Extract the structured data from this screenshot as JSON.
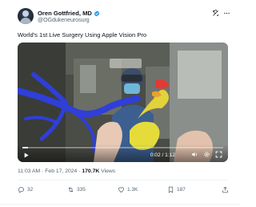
{
  "author": {
    "display_name": "Oren Gottfried, MD",
    "handle": "@OGdukeneurosurg",
    "verified": true,
    "verified_color": "#1d9bf0"
  },
  "header_actions": [
    "grok-icon",
    "more-icon"
  ],
  "tweet": {
    "text": "World's 1st Live Surgery Using Apple Vision Pro"
  },
  "video": {
    "current_time": "0:02",
    "duration": "1:12",
    "progress_fraction": 0.028,
    "controls": [
      "play-icon",
      "volume-icon",
      "settings-icon",
      "fullscreen-icon"
    ]
  },
  "meta": {
    "time": "11:03 AM",
    "separator": "·",
    "date": "Feb 17, 2024",
    "views_count": "170.7K",
    "views_label": "Views"
  },
  "actions": {
    "replies": "32",
    "reposts": "335",
    "likes": "1.3K",
    "bookmarks": "187"
  }
}
